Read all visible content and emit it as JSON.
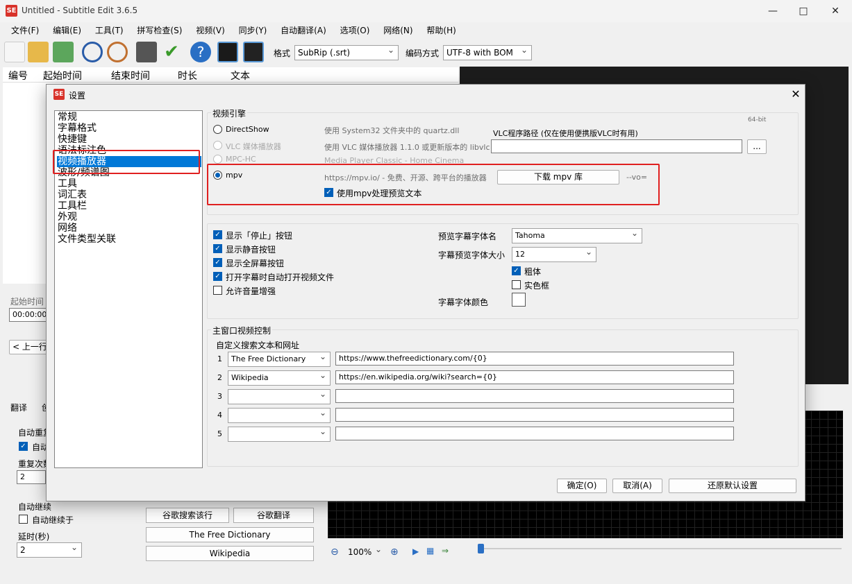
{
  "window": {
    "title": "Untitled - Subtitle Edit 3.6.5",
    "logo": "SE"
  },
  "menu": [
    "文件(F)",
    "编辑(E)",
    "工具(T)",
    "拼写检查(S)",
    "视频(V)",
    "同步(Y)",
    "自动翻译(A)",
    "选项(O)",
    "网络(N)",
    "帮助(H)"
  ],
  "toolbar": {
    "format_label": "格式",
    "format_value": "SubRip (.srt)",
    "encoding_label": "编码方式",
    "encoding_value": "UTF-8 with BOM"
  },
  "grid": {
    "columns": [
      "编号",
      "起始时间",
      "结束时间",
      "时长",
      "文本"
    ]
  },
  "background": {
    "start_time_label": "起始时间",
    "start_time_value": "00:00:00.",
    "prev_label": "< 上一行",
    "tab_translate": "翻译",
    "tab_other": "创",
    "auto_repeat": "自动重复",
    "auto_repeat_on": "自动",
    "repeat_count_label": "重复次数",
    "repeat_count_value": "2",
    "auto_continue": "自动继续",
    "auto_continue_in": "自动继续于",
    "delay_label": "延时(秒)",
    "delay_value": "2",
    "google_search": "谷歌搜索该行",
    "google_translate": "谷歌翻译",
    "free_dict": "The Free Dictionary",
    "wikipedia": "Wikipedia",
    "zoom": "100%"
  },
  "dialog": {
    "title": "设置",
    "logo": "SE",
    "nav": [
      "常规",
      "字幕格式",
      "快捷键",
      "语法标注色",
      "视频播放器",
      "波形/频谱图",
      "工具",
      "词汇表",
      "工具栏",
      "外观",
      "网络",
      "文件类型关联"
    ],
    "nav_selected": 4,
    "engine": {
      "group_label": "视频引擎",
      "bitness": "64-bit",
      "directshow": "DirectShow",
      "directshow_desc": "使用 System32 文件夹中的 quartz.dll",
      "vlc": "VLC 媒体播放器",
      "vlc_desc": "使用 VLC 媒体播放器 1.1.0 或更新版本的 libvlc",
      "vlc_path_label": "VLC程序路径 (仅在使用便携版VLC时有用)",
      "vlc_browse": "...",
      "mpchc": "MPC-HC",
      "mpchc_desc": "Media Player Classic - Home Cinema",
      "mpv": "mpv",
      "mpv_desc": "https://mpv.io/ - 免费、开源、跨平台的播放器",
      "mpv_download": "下载 mpv 库",
      "mpv_vo": "--vo=",
      "mpv_preview": "使用mpv处理预览文本"
    },
    "options": {
      "show_stop": "显示「停止」按钮",
      "show_mute": "显示静音按钮",
      "show_fullscreen": "显示全屏幕按钮",
      "auto_open": "打开字幕时自动打开视频文件",
      "allow_boost": "允许音量增强",
      "font_name_label": "预览字幕字体名",
      "font_name": "Tahoma",
      "font_size_label": "字幕预览字体大小",
      "font_size": "12",
      "bold": "粗体",
      "box": "实色框",
      "font_color_label": "字幕字体颜色"
    },
    "main_ctrl": {
      "group_label": "主窗口视频控制",
      "search_label": "自定义搜索文本和网址",
      "rows": [
        {
          "n": "1",
          "name": "The Free Dictionary",
          "url": "https://www.thefreedictionary.com/{0}"
        },
        {
          "n": "2",
          "name": "Wikipedia",
          "url": "https://en.wikipedia.org/wiki?search={0}"
        },
        {
          "n": "3",
          "name": "",
          "url": ""
        },
        {
          "n": "4",
          "name": "",
          "url": ""
        },
        {
          "n": "5",
          "name": "",
          "url": ""
        }
      ]
    },
    "buttons": {
      "ok": "确定(O)",
      "cancel": "取消(A)",
      "restore": "还原默认设置"
    }
  },
  "colors": {
    "accent": "#0078d7",
    "highlight_box": "#e02020",
    "brand": "#d8322a"
  }
}
